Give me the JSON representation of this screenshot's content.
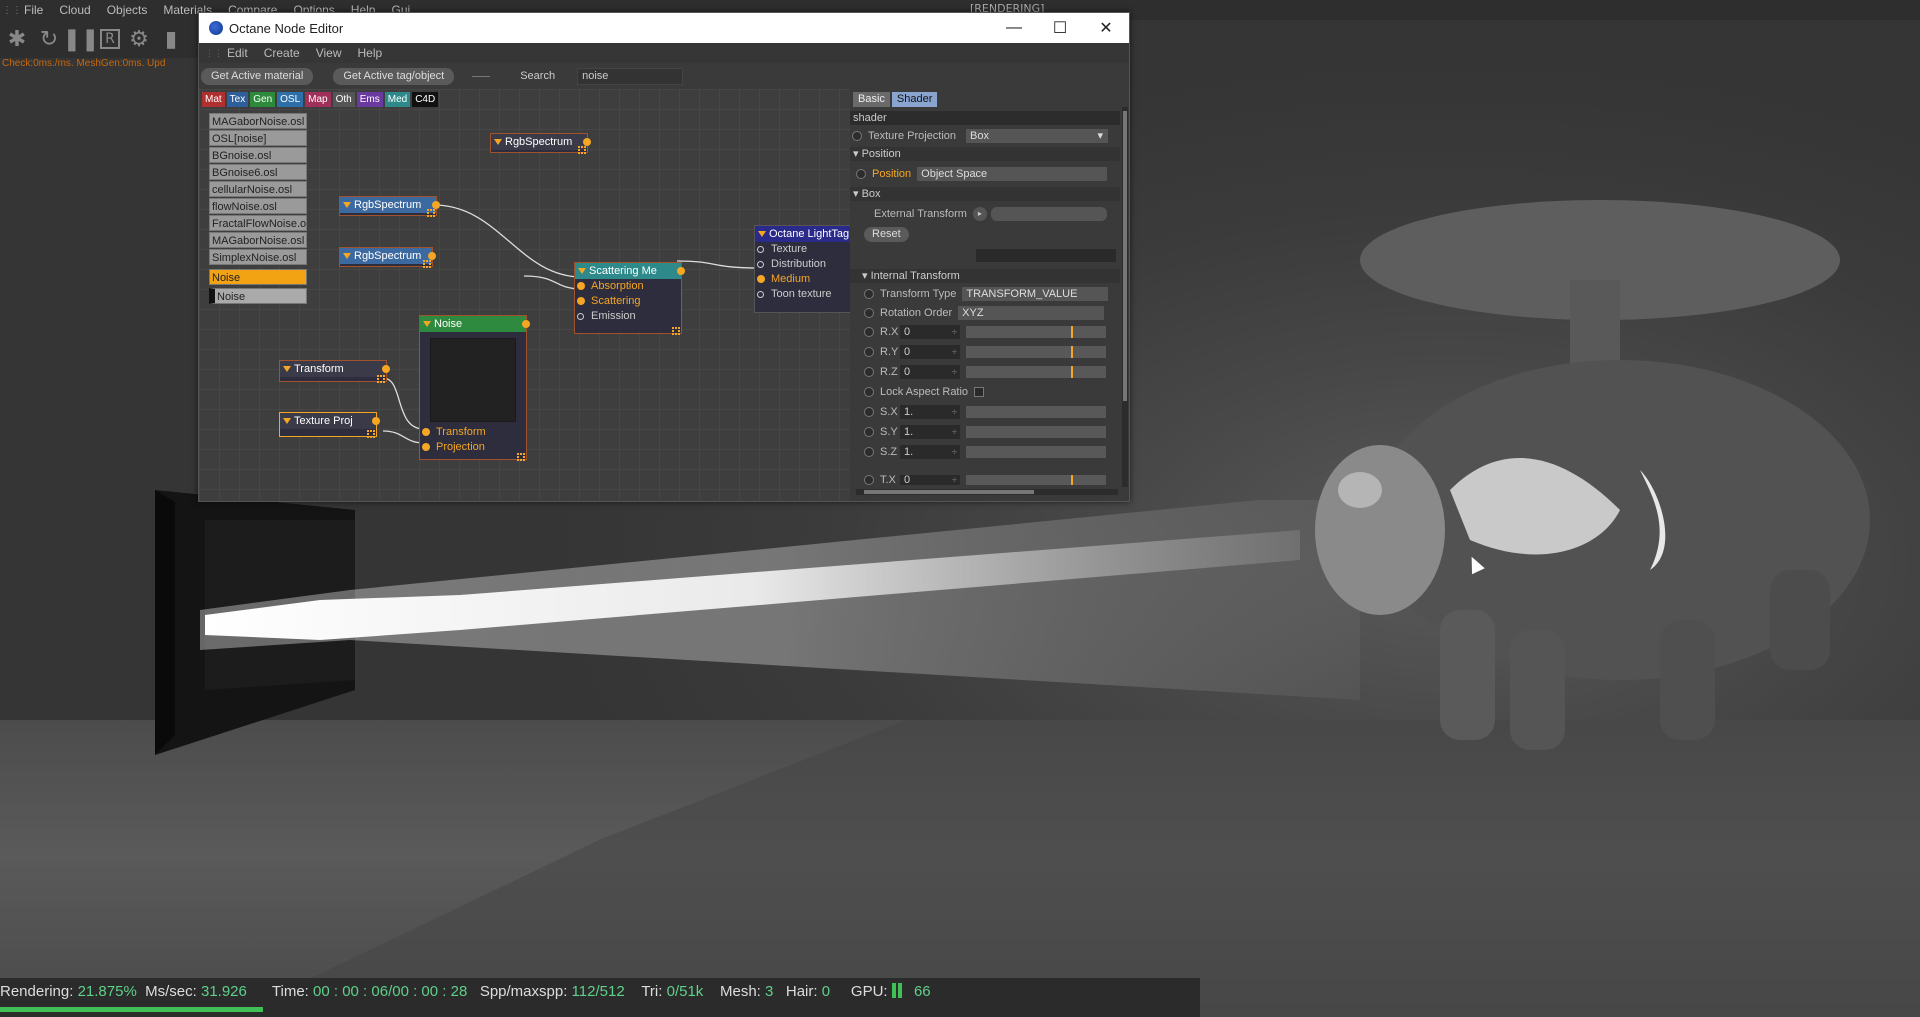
{
  "app": {
    "menu": [
      "File",
      "Cloud",
      "Objects",
      "Materials",
      "Compare",
      "Options",
      "Help",
      "Gui"
    ],
    "rendering_label": "[RENDERING]",
    "check_line": "Check:0ms./ms. MeshGen:0ms. Upd"
  },
  "status": {
    "rendering_label": "Rendering:",
    "rendering_value": "21.875%",
    "mssec_label": "Ms/sec:",
    "mssec_value": "31.926",
    "time_label": "Time:",
    "time_value": "00 : 00 : 06/00 : 00 : 28",
    "spp_label": "Spp/maxspp:",
    "spp_value": "112/512",
    "tri_label": "Tri:",
    "tri_value": "0/51k",
    "mesh_label": "Mesh:",
    "mesh_value": "3",
    "hair_label": "Hair:",
    "hair_value": "0",
    "gpu_label": "GPU:",
    "gpu_value": "66",
    "progress": 0.21875
  },
  "window": {
    "title": "Octane Node Editor",
    "menu": [
      "Edit",
      "Create",
      "View",
      "Help"
    ],
    "toolbar": {
      "get_material": "Get Active material",
      "get_tag": "Get Active tag/object",
      "search_label": "Search",
      "search_value": "noise"
    },
    "categories": [
      {
        "label": "Mat",
        "color": "#b03030"
      },
      {
        "label": "Tex",
        "color": "#2f5f9a"
      },
      {
        "label": "Gen",
        "color": "#2d8a3a"
      },
      {
        "label": "OSL",
        "color": "#2d6fa8"
      },
      {
        "label": "Map",
        "color": "#a0305a"
      },
      {
        "label": "Oth",
        "color": "#555555"
      },
      {
        "label": "Ems",
        "color": "#6a3aa0"
      },
      {
        "label": "Med",
        "color": "#2e8a8a"
      },
      {
        "label": "C4D",
        "color": "#111111"
      }
    ],
    "osl_list": [
      "MAGaborNoise.osl",
      "OSL[noise]",
      "BGnoise.osl",
      "BGnoise6.osl",
      "cellularNoise.osl",
      "flowNoise.osl",
      "FractalFlowNoise.o",
      "MAGaborNoise.osl",
      "SimplexNoise.osl"
    ],
    "osl_selected": "Noise",
    "osl_second": "Noise",
    "nodes": {
      "rgb1": "RgbSpectrum",
      "rgb2": "RgbSpectrum",
      "rgb3": "RgbSpectrum",
      "scattering": "Scattering Me",
      "scattering_ports": [
        "Absorption",
        "Scattering",
        "Emission"
      ],
      "lighttag": "Octane LightTag",
      "lighttag_ports": [
        "Texture",
        "Distribution",
        "Medium",
        "Toon texture"
      ],
      "noise": "Noise",
      "noise_ports": [
        "Transform",
        "Projection"
      ],
      "transform": "Transform",
      "texproj": "Texture Proj"
    },
    "attr": {
      "tabs": [
        "Basic",
        "Shader"
      ],
      "header": "shader",
      "texture_projection_label": "Texture Projection",
      "texture_projection_value": "Box",
      "position_section": "Position",
      "position_label": "Position",
      "position_value": "Object Space",
      "box_section": "Box",
      "external_transform_label": "External Transform",
      "reset_label": "Reset",
      "internal_section": "Internal Transform",
      "transform_type_label": "Transform Type",
      "transform_type_value": "TRANSFORM_VALUE",
      "rotation_order_label": "Rotation Order",
      "rotation_order_value": "XYZ",
      "rx_label": "R.X",
      "rx_value": "0",
      "ry_label": "R.Y",
      "ry_value": "0",
      "rz_label": "R.Z",
      "rz_value": "0",
      "lock_label": "Lock Aspect Ratio",
      "sx_label": "S.X",
      "sx_value": "1.",
      "sy_label": "S.Y",
      "sy_value": "1.",
      "sz_label": "S.Z",
      "sz_value": "1.",
      "tx_label": "T.X",
      "tx_value": "0"
    }
  }
}
